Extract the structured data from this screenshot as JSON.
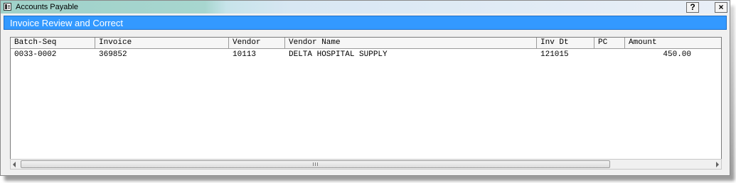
{
  "window": {
    "title": "Accounts Payable",
    "help_label": "?",
    "close_label": "×"
  },
  "banner": {
    "text": "Invoice Review and Correct"
  },
  "table": {
    "columns": [
      "Batch-Seq",
      "Invoice",
      "Vendor",
      "Vendor Name",
      "Inv Dt",
      "PC",
      "Amount"
    ],
    "rows": [
      {
        "batch_seq": "0033-0002",
        "invoice": "369852",
        "vendor": "10113",
        "vendor_name": "DELTA HOSPITAL SUPPLY",
        "inv_dt": "121015",
        "pc": "",
        "amount": "450.00"
      }
    ]
  },
  "colors": {
    "banner_bg": "#3399ff",
    "banner_text": "#ffffff",
    "window_bg": "#f0f0f0"
  },
  "icons": [
    "app-window-icon",
    "help-icon",
    "close-icon",
    "scroll-left-arrow-icon",
    "scroll-right-arrow-icon"
  ]
}
